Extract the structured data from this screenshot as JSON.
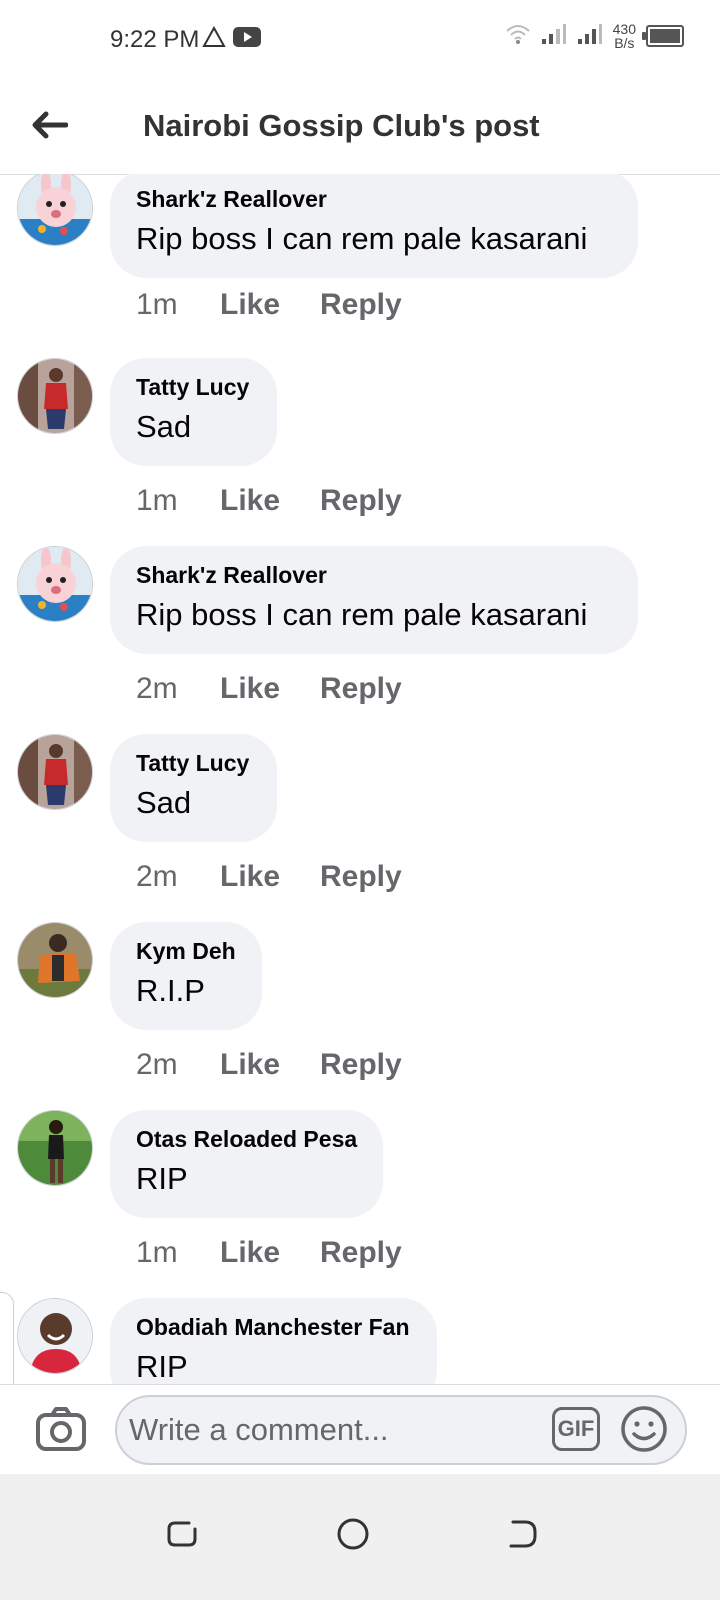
{
  "status_bar": {
    "time": "9:22 PM",
    "speed_value": "430",
    "speed_unit": "B/s",
    "icons": [
      "alert-triangle-icon",
      "youtube-icon",
      "wifi-icon",
      "signal-icon",
      "signal-icon",
      "battery-icon"
    ]
  },
  "header": {
    "title": "Nairobi Gossip Club's post",
    "back_icon": "back-arrow-icon"
  },
  "comments": [
    {
      "author": "Shark'z Reallover",
      "text": "Rip boss I can rem pale kasarani",
      "time": "1m",
      "like": "Like",
      "reply": "Reply"
    },
    {
      "author": "Tatty Lucy",
      "text": "Sad",
      "time": "1m",
      "like": "Like",
      "reply": "Reply"
    },
    {
      "author": "Shark'z Reallover",
      "text": "Rip boss I can rem pale kasarani",
      "time": "2m",
      "like": "Like",
      "reply": "Reply"
    },
    {
      "author": "Tatty Lucy",
      "text": "Sad",
      "time": "2m",
      "like": "Like",
      "reply": "Reply"
    },
    {
      "author": "Kym Deh",
      "text": "R.I.P",
      "time": "2m",
      "like": "Like",
      "reply": "Reply"
    },
    {
      "author": "Otas Reloaded Pesa",
      "text": "RIP",
      "time": "1m",
      "like": "Like",
      "reply": "Reply"
    },
    {
      "author": "Obadiah Manchester Fan",
      "text": "RIP",
      "time": "",
      "like": "",
      "reply": ""
    }
  ],
  "composer": {
    "placeholder": "Write a comment...",
    "gif_label": "GIF",
    "camera_icon": "camera-icon",
    "emoji_icon": "emoji-icon"
  },
  "navigation": {
    "icons": [
      "recent-apps-icon",
      "home-circle-icon",
      "back-nav-icon"
    ]
  },
  "colors": {
    "bubble": "#f0f2f5",
    "meta_text": "#65676b",
    "title_text": "#333333"
  }
}
